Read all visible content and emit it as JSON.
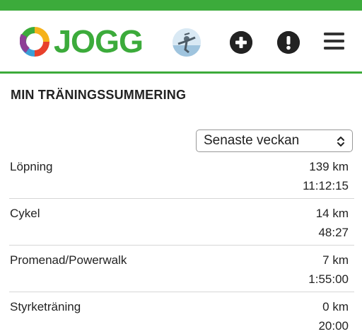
{
  "colors": {
    "brand_green": "#3cab3b",
    "icon_dark": "#222222"
  },
  "header": {
    "logo_text": "JOGG",
    "icons": [
      "avatar-photo",
      "plus-circle-icon",
      "exclamation-circle-icon",
      "hamburger-menu-icon"
    ]
  },
  "page": {
    "title": "MIN TRÄNINGSSUMMERING"
  },
  "period_select": {
    "selected": "Senaste veckan"
  },
  "activities": [
    {
      "label": "Löpning",
      "distance": "139 km",
      "time": "11:12:15"
    },
    {
      "label": "Cykel",
      "distance": "14 km",
      "time": "48:27"
    },
    {
      "label": "Promenad/Powerwalk",
      "distance": "7 km",
      "time": "1:55:00"
    },
    {
      "label": "Styrketräning",
      "distance": "0 km",
      "time": "20:00"
    }
  ]
}
